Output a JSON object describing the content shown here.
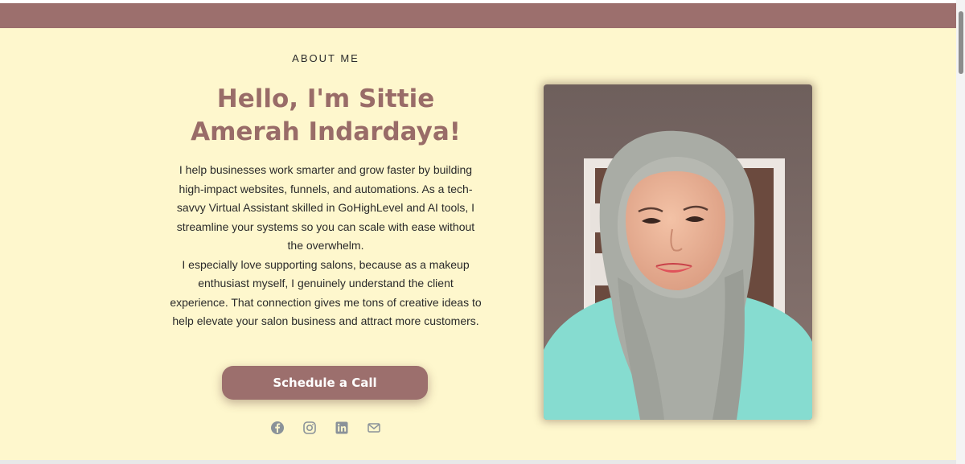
{
  "about": {
    "eyebrow": "ABOUT ME",
    "headline_line1": "Hello, I'm Sittie",
    "headline_line2": "Amerah Indardaya!",
    "bio": [
      "I help businesses work smarter and grow faster by building high-impact websites, funnels, and automations. As a tech-savvy Virtual Assistant skilled in GoHighLevel and AI tools, I streamline your systems so you can scale with ease without the overwhelm.",
      "I especially love supporting salons, because as a makeup enthusiast myself, I genuinely understand the client experience. That connection gives me tons of creative ideas to help elevate your salon business and attract more customers."
    ],
    "cta_label": "Schedule a Call"
  },
  "socials": [
    {
      "icon": "facebook-icon"
    },
    {
      "icon": "instagram-icon"
    },
    {
      "icon": "linkedin-icon"
    },
    {
      "icon": "email-icon"
    }
  ],
  "colors": {
    "brand": "#9c6f6d",
    "headline": "#996c68",
    "background": "#fef7cd",
    "icon": "#8a9299"
  }
}
